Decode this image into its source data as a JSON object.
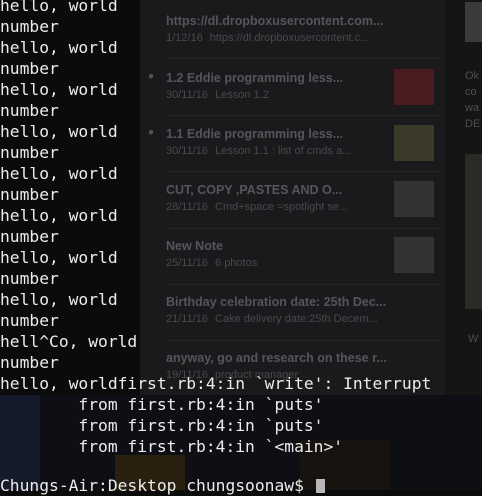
{
  "notes": [
    {
      "title": "https://dl.dropboxusercontent.com...",
      "date": "1/12/16",
      "snippet": "https://dl.dropboxusercontent.c..."
    },
    {
      "title": "1.2 Eddie programming less...",
      "date": "30/11/16",
      "snippet": "Lesson 1.2",
      "locked": "lock-icon"
    },
    {
      "title": "1.1 Eddie programming less...",
      "date": "30/11/16",
      "snippet": "Lesson 1.1 : list of cmds a...",
      "locked": "lock-icon"
    },
    {
      "title": "CUT, COPY ,PASTES AND O...",
      "date": "28/11/16",
      "snippet": "Cmd+space =spotlight se..."
    },
    {
      "title": "New Note",
      "date": "25/11/16",
      "snippet": "6 photos"
    },
    {
      "title": "Birthday celebration date: 25th Dec...",
      "date": "21/11/16",
      "snippet": "Cake delivery date:25th Decem..."
    },
    {
      "title": "anyway, go and research on these r...",
      "date": "19/11/16",
      "snippet": "product manager"
    }
  ],
  "right_panel": {
    "line1": "Ok",
    "line2": "co",
    "line3": "wa",
    "line4": "DE",
    "line5": "W"
  },
  "terminal": {
    "lines": [
      "hello, world",
      "number",
      "hello, world",
      "number",
      "hello, world",
      "number",
      "hello, world",
      "number",
      "hello, world",
      "number",
      "hello, world",
      "number",
      "hello, world",
      "number",
      "hello, world",
      "number",
      "hell^Co, world",
      "number",
      "hello, worldfirst.rb:4:in `write': Interrupt",
      "        from first.rb:4:in `puts'",
      "        from first.rb:4:in `puts'",
      "        from first.rb:4:in `<main>'",
      "",
      "Chungs-Air:Desktop chungsoonaw$ "
    ]
  }
}
